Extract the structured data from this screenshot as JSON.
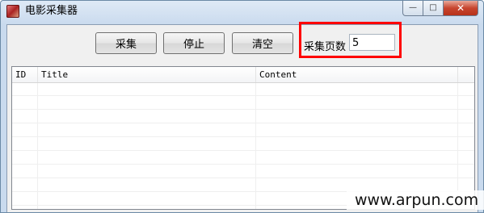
{
  "window": {
    "title": "电影采集器"
  },
  "toolbar": {
    "collect_label": "采集",
    "stop_label": "停止",
    "clear_label": "清空",
    "pages_label": "采集页数",
    "pages_value": "5"
  },
  "table": {
    "columns": [
      "ID",
      "Title",
      "Content"
    ],
    "rows": []
  },
  "watermark": "www.arpun.com",
  "colors": {
    "highlight": "#ff0000",
    "close_button": "#c7452f"
  }
}
